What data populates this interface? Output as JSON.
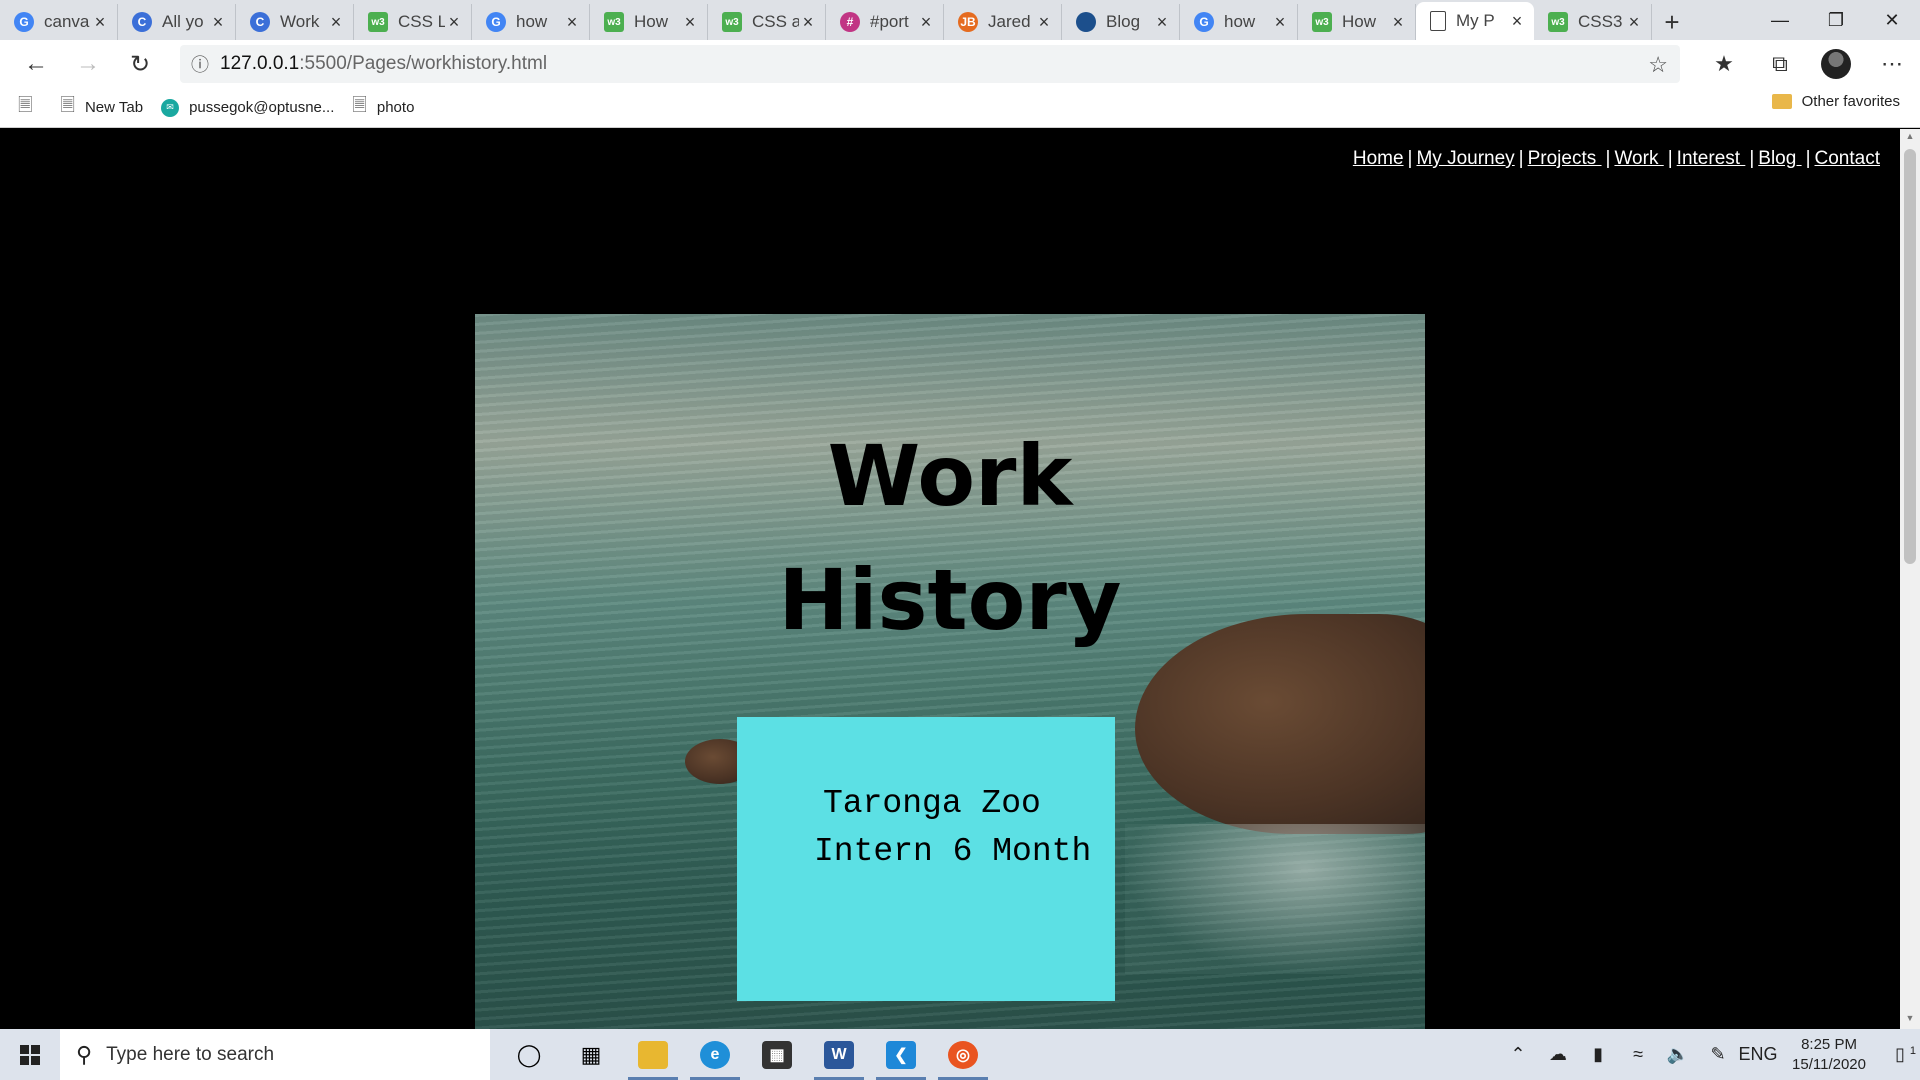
{
  "browser": {
    "tabs": [
      {
        "label": "canva",
        "favicon": "google-icon",
        "color": "#4285f4"
      },
      {
        "label": "All yo",
        "favicon": "c-icon",
        "color": "#3b6fd8"
      },
      {
        "label": "Work",
        "favicon": "c-icon",
        "color": "#3b6fd8"
      },
      {
        "label": "CSS L",
        "favicon": "w3schools-icon",
        "color": "#4caf50"
      },
      {
        "label": "how",
        "favicon": "google-icon",
        "color": "#4285f4"
      },
      {
        "label": "How",
        "favicon": "w3schools-icon",
        "color": "#4caf50"
      },
      {
        "label": "CSS a",
        "favicon": "w3schools-icon",
        "color": "#4caf50"
      },
      {
        "label": "#port",
        "favicon": "instagram-icon",
        "color": "#c13584"
      },
      {
        "label": "Jared",
        "favicon": "jb-icon",
        "color": "#e56b1f"
      },
      {
        "label": "Blog",
        "favicon": "blog-icon",
        "color": "#1c4f8c"
      },
      {
        "label": "how",
        "favicon": "google-icon",
        "color": "#4285f4"
      },
      {
        "label": "How",
        "favicon": "w3schools-icon",
        "color": "#4caf50"
      },
      {
        "label": "My P",
        "favicon": "page-icon",
        "color": "#ffffff",
        "active": true
      },
      {
        "label": "CSS3",
        "favicon": "w3schools-icon",
        "color": "#4caf50"
      }
    ],
    "url_host": "127.0.0.1",
    "url_path": ":5500/Pages/workhistory.html",
    "bookmarks": [
      {
        "label": "New Tab"
      },
      {
        "label": "pussegok@optusne..."
      },
      {
        "label": "photo"
      }
    ],
    "other_favorites": "Other favorites"
  },
  "page": {
    "nav": [
      {
        "label": "Home"
      },
      {
        "label": "My Journey"
      },
      {
        "label": "Projects "
      },
      {
        "label": "Work "
      },
      {
        "label": "Interest "
      },
      {
        "label": "Blog "
      },
      {
        "label": "Contact"
      }
    ],
    "title_line1": "Work",
    "title_line2": "History",
    "job": {
      "line1": "Taronga Zoo",
      "line2": "Intern 6 Month"
    },
    "colors": {
      "job_card": "#5ce0e4",
      "background": "#000000"
    }
  },
  "taskbar": {
    "search_placeholder": "Type here to search",
    "language": "ENG",
    "time": "8:25 PM",
    "date": "15/11/2020",
    "notification_count": "1"
  }
}
